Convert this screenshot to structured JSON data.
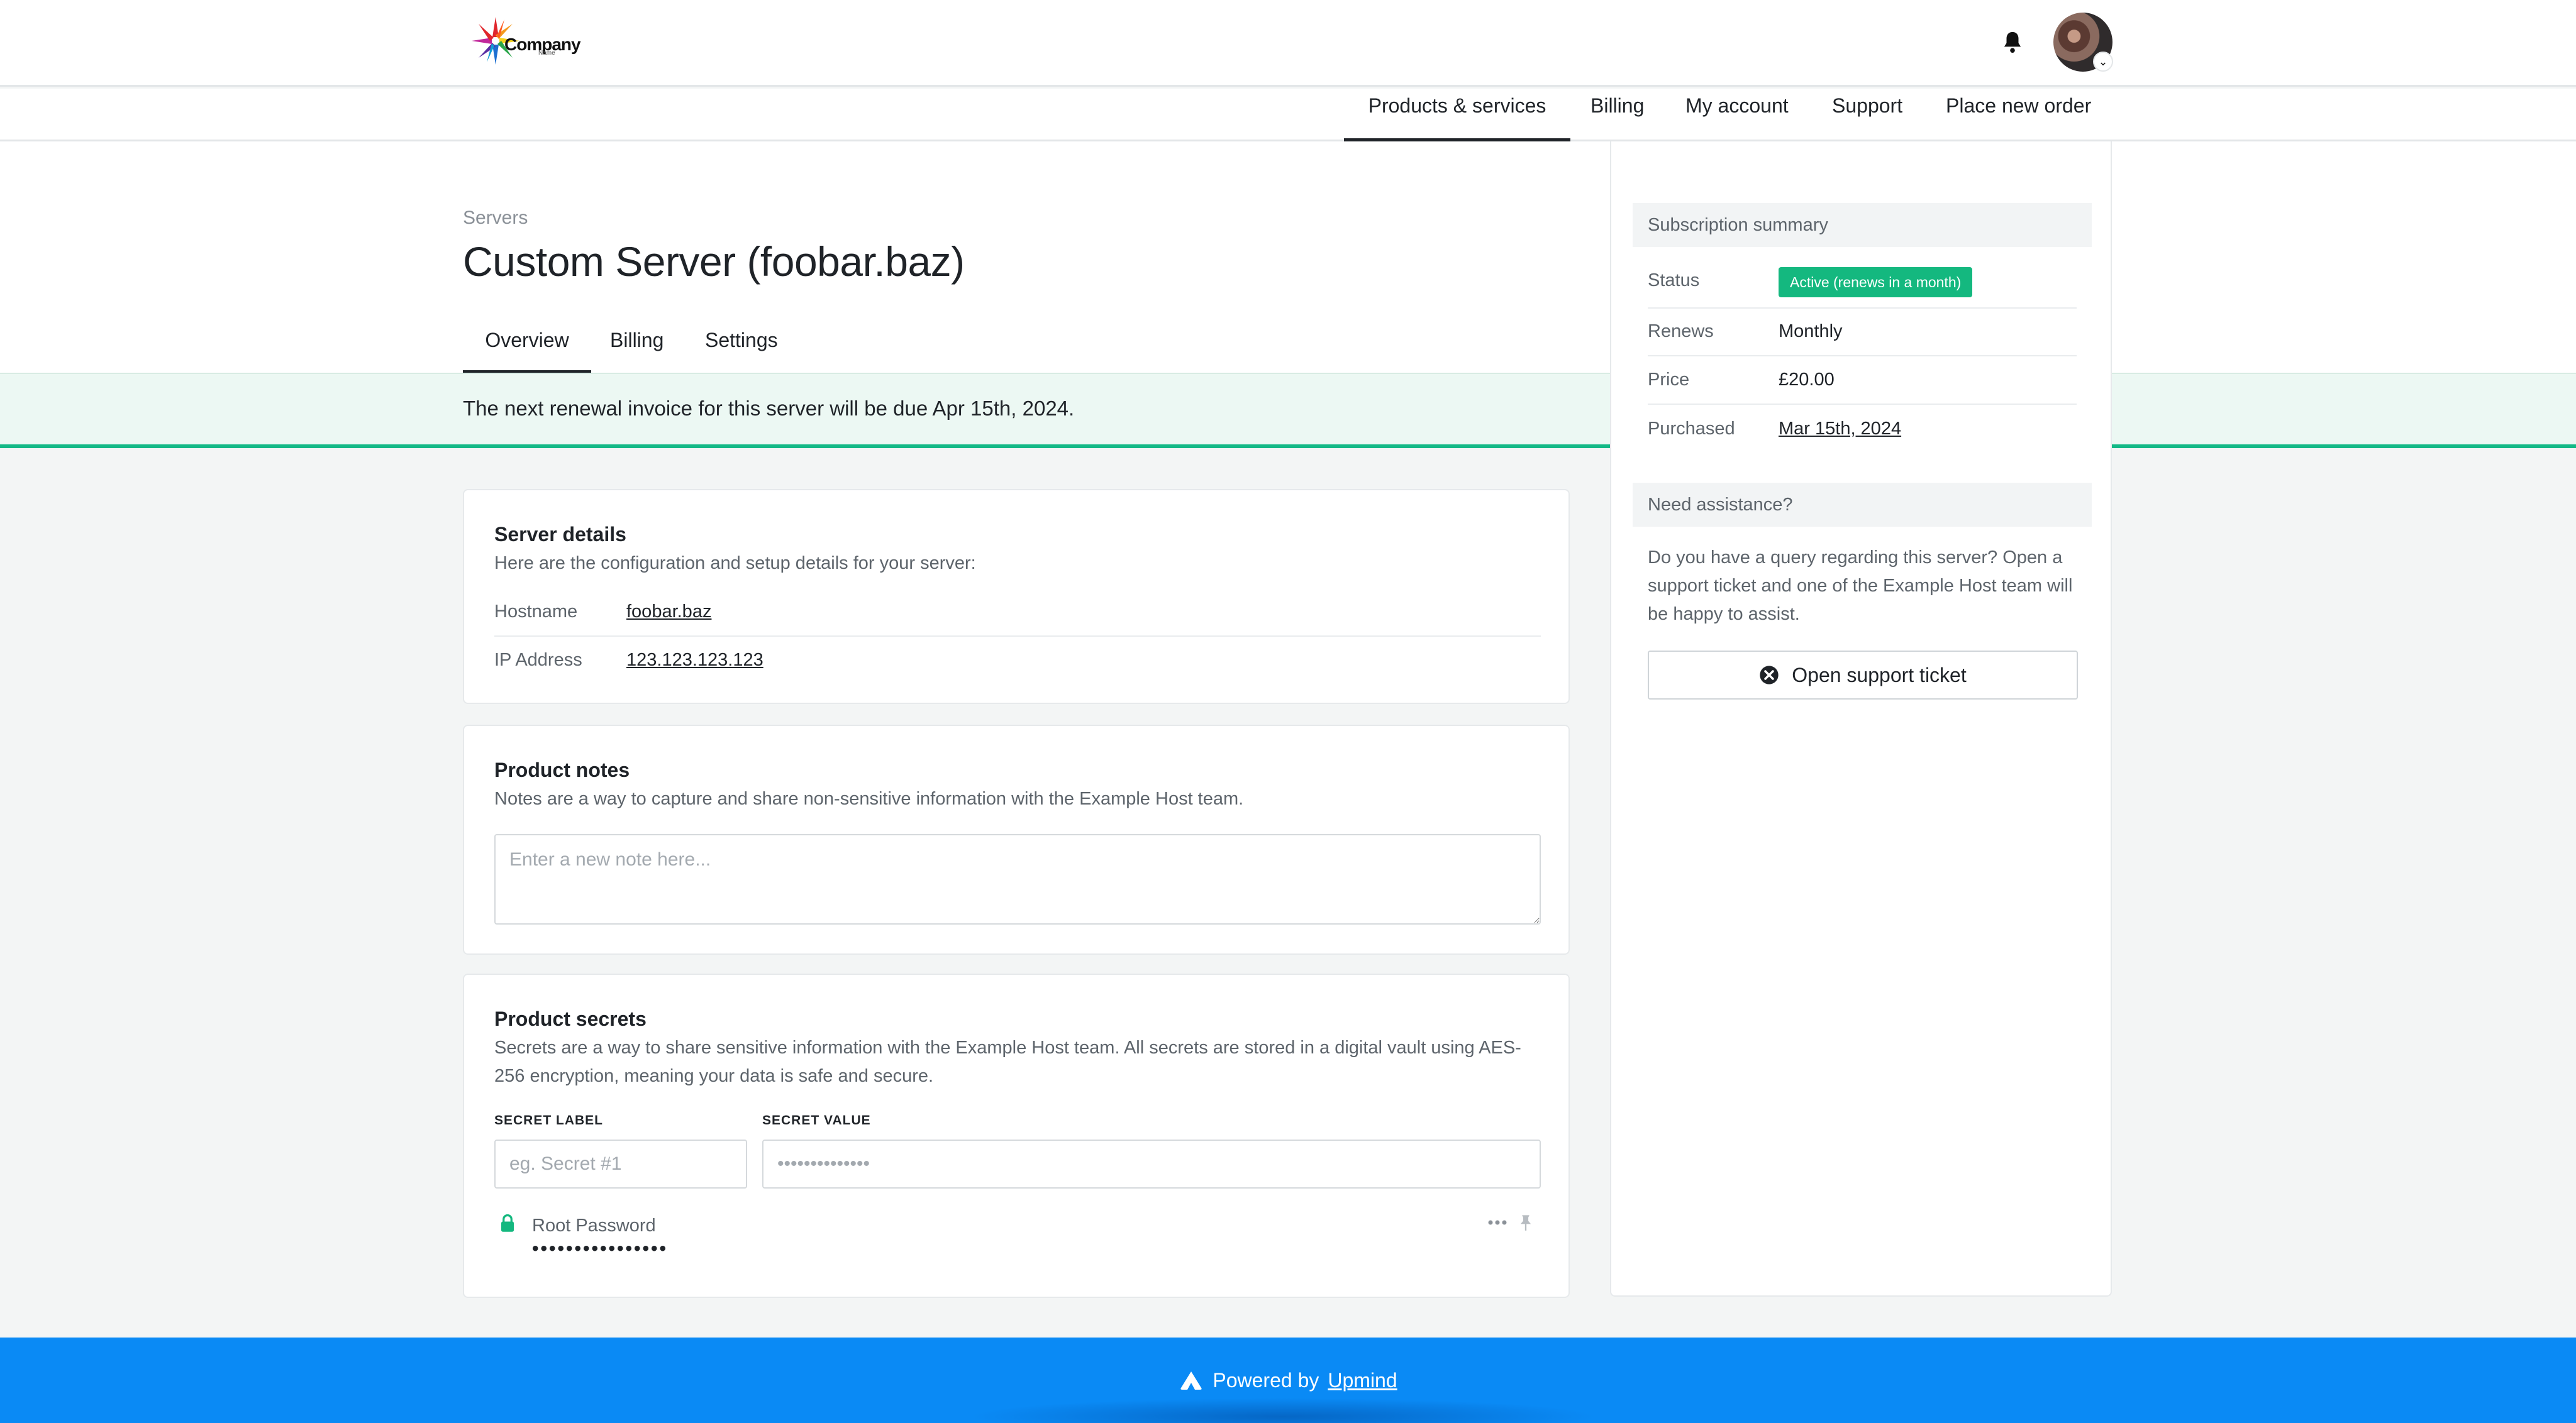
{
  "header": {
    "logo_text": "Company",
    "logo_subtext": "Name"
  },
  "nav": {
    "items": [
      "Products & services",
      "Billing",
      "My account",
      "Support",
      "Place new order"
    ]
  },
  "page": {
    "breadcrumb": "Servers",
    "title": "Custom Server (foobar.baz)",
    "tabs": [
      "Overview",
      "Billing",
      "Settings"
    ],
    "banner": "The next renewal invoice for this server will be due Apr 15th, 2024."
  },
  "server_details": {
    "title": "Server details",
    "description": "Here are the configuration and setup details for your server:",
    "rows": [
      {
        "label": "Hostname",
        "value": "foobar.baz"
      },
      {
        "label": "IP Address",
        "value": "123.123.123.123"
      }
    ]
  },
  "product_notes": {
    "title": "Product notes",
    "description": "Notes are a way to capture and share non-sensitive information with the Example Host team.",
    "placeholder": "Enter a new note here..."
  },
  "product_secrets": {
    "title": "Product secrets",
    "description": "Secrets are a way to share sensitive information with the Example Host team. All secrets are stored in a digital vault using AES-256 encryption, meaning your data is safe and secure.",
    "label_header": "SECRET LABEL",
    "value_header": "SECRET VALUE",
    "label_placeholder": "eg. Secret #1",
    "value_placeholder": "••••••••••••••",
    "secret_name": "Root Password",
    "secret_dots": "••••••••••••••••"
  },
  "sidebar": {
    "summary_title": "Subscription summary",
    "rows": [
      {
        "label": "Status",
        "value": "Active (renews in a month)"
      },
      {
        "label": "Renews",
        "value": "Monthly"
      },
      {
        "label": "Price",
        "value": "£20.00"
      },
      {
        "label": "Purchased",
        "value": "Mar 15th, 2024"
      }
    ],
    "assist_title": "Need assistance?",
    "assist_text": "Do you have a query regarding this server? Open a support ticket and one of the Example Host team will be happy to assist.",
    "ticket_button": "Open support ticket"
  },
  "footer": {
    "powered_by": "Powered by",
    "brand": "Upmind"
  },
  "colors": {
    "accent_green": "#14b87f",
    "footer_blue": "#0a8af5",
    "banner_bg": "#ecf8f3"
  },
  "icons": [
    "company-logo",
    "bell-icon",
    "avatar",
    "chevron-down-icon",
    "lock-icon",
    "more-icon",
    "pin-icon",
    "support-ticket-icon",
    "upmind-logo-icon"
  ]
}
